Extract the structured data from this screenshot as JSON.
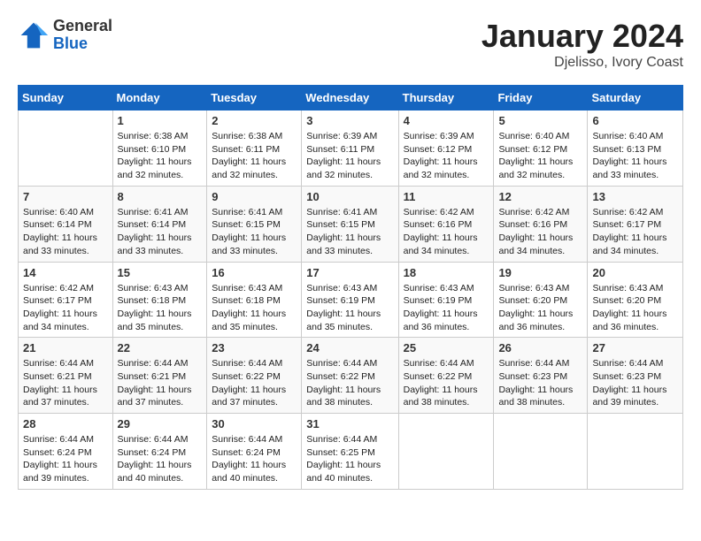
{
  "logo": {
    "general": "General",
    "blue": "Blue"
  },
  "title": "January 2024",
  "subtitle": "Djelisso, Ivory Coast",
  "days_of_week": [
    "Sunday",
    "Monday",
    "Tuesday",
    "Wednesday",
    "Thursday",
    "Friday",
    "Saturday"
  ],
  "weeks": [
    [
      {
        "num": "",
        "sunrise": "",
        "sunset": "",
        "daylight": ""
      },
      {
        "num": "1",
        "sunrise": "Sunrise: 6:38 AM",
        "sunset": "Sunset: 6:10 PM",
        "daylight": "Daylight: 11 hours and 32 minutes."
      },
      {
        "num": "2",
        "sunrise": "Sunrise: 6:38 AM",
        "sunset": "Sunset: 6:11 PM",
        "daylight": "Daylight: 11 hours and 32 minutes."
      },
      {
        "num": "3",
        "sunrise": "Sunrise: 6:39 AM",
        "sunset": "Sunset: 6:11 PM",
        "daylight": "Daylight: 11 hours and 32 minutes."
      },
      {
        "num": "4",
        "sunrise": "Sunrise: 6:39 AM",
        "sunset": "Sunset: 6:12 PM",
        "daylight": "Daylight: 11 hours and 32 minutes."
      },
      {
        "num": "5",
        "sunrise": "Sunrise: 6:40 AM",
        "sunset": "Sunset: 6:12 PM",
        "daylight": "Daylight: 11 hours and 32 minutes."
      },
      {
        "num": "6",
        "sunrise": "Sunrise: 6:40 AM",
        "sunset": "Sunset: 6:13 PM",
        "daylight": "Daylight: 11 hours and 33 minutes."
      }
    ],
    [
      {
        "num": "7",
        "sunrise": "Sunrise: 6:40 AM",
        "sunset": "Sunset: 6:14 PM",
        "daylight": "Daylight: 11 hours and 33 minutes."
      },
      {
        "num": "8",
        "sunrise": "Sunrise: 6:41 AM",
        "sunset": "Sunset: 6:14 PM",
        "daylight": "Daylight: 11 hours and 33 minutes."
      },
      {
        "num": "9",
        "sunrise": "Sunrise: 6:41 AM",
        "sunset": "Sunset: 6:15 PM",
        "daylight": "Daylight: 11 hours and 33 minutes."
      },
      {
        "num": "10",
        "sunrise": "Sunrise: 6:41 AM",
        "sunset": "Sunset: 6:15 PM",
        "daylight": "Daylight: 11 hours and 33 minutes."
      },
      {
        "num": "11",
        "sunrise": "Sunrise: 6:42 AM",
        "sunset": "Sunset: 6:16 PM",
        "daylight": "Daylight: 11 hours and 34 minutes."
      },
      {
        "num": "12",
        "sunrise": "Sunrise: 6:42 AM",
        "sunset": "Sunset: 6:16 PM",
        "daylight": "Daylight: 11 hours and 34 minutes."
      },
      {
        "num": "13",
        "sunrise": "Sunrise: 6:42 AM",
        "sunset": "Sunset: 6:17 PM",
        "daylight": "Daylight: 11 hours and 34 minutes."
      }
    ],
    [
      {
        "num": "14",
        "sunrise": "Sunrise: 6:42 AM",
        "sunset": "Sunset: 6:17 PM",
        "daylight": "Daylight: 11 hours and 34 minutes."
      },
      {
        "num": "15",
        "sunrise": "Sunrise: 6:43 AM",
        "sunset": "Sunset: 6:18 PM",
        "daylight": "Daylight: 11 hours and 35 minutes."
      },
      {
        "num": "16",
        "sunrise": "Sunrise: 6:43 AM",
        "sunset": "Sunset: 6:18 PM",
        "daylight": "Daylight: 11 hours and 35 minutes."
      },
      {
        "num": "17",
        "sunrise": "Sunrise: 6:43 AM",
        "sunset": "Sunset: 6:19 PM",
        "daylight": "Daylight: 11 hours and 35 minutes."
      },
      {
        "num": "18",
        "sunrise": "Sunrise: 6:43 AM",
        "sunset": "Sunset: 6:19 PM",
        "daylight": "Daylight: 11 hours and 36 minutes."
      },
      {
        "num": "19",
        "sunrise": "Sunrise: 6:43 AM",
        "sunset": "Sunset: 6:20 PM",
        "daylight": "Daylight: 11 hours and 36 minutes."
      },
      {
        "num": "20",
        "sunrise": "Sunrise: 6:43 AM",
        "sunset": "Sunset: 6:20 PM",
        "daylight": "Daylight: 11 hours and 36 minutes."
      }
    ],
    [
      {
        "num": "21",
        "sunrise": "Sunrise: 6:44 AM",
        "sunset": "Sunset: 6:21 PM",
        "daylight": "Daylight: 11 hours and 37 minutes."
      },
      {
        "num": "22",
        "sunrise": "Sunrise: 6:44 AM",
        "sunset": "Sunset: 6:21 PM",
        "daylight": "Daylight: 11 hours and 37 minutes."
      },
      {
        "num": "23",
        "sunrise": "Sunrise: 6:44 AM",
        "sunset": "Sunset: 6:22 PM",
        "daylight": "Daylight: 11 hours and 37 minutes."
      },
      {
        "num": "24",
        "sunrise": "Sunrise: 6:44 AM",
        "sunset": "Sunset: 6:22 PM",
        "daylight": "Daylight: 11 hours and 38 minutes."
      },
      {
        "num": "25",
        "sunrise": "Sunrise: 6:44 AM",
        "sunset": "Sunset: 6:22 PM",
        "daylight": "Daylight: 11 hours and 38 minutes."
      },
      {
        "num": "26",
        "sunrise": "Sunrise: 6:44 AM",
        "sunset": "Sunset: 6:23 PM",
        "daylight": "Daylight: 11 hours and 38 minutes."
      },
      {
        "num": "27",
        "sunrise": "Sunrise: 6:44 AM",
        "sunset": "Sunset: 6:23 PM",
        "daylight": "Daylight: 11 hours and 39 minutes."
      }
    ],
    [
      {
        "num": "28",
        "sunrise": "Sunrise: 6:44 AM",
        "sunset": "Sunset: 6:24 PM",
        "daylight": "Daylight: 11 hours and 39 minutes."
      },
      {
        "num": "29",
        "sunrise": "Sunrise: 6:44 AM",
        "sunset": "Sunset: 6:24 PM",
        "daylight": "Daylight: 11 hours and 40 minutes."
      },
      {
        "num": "30",
        "sunrise": "Sunrise: 6:44 AM",
        "sunset": "Sunset: 6:24 PM",
        "daylight": "Daylight: 11 hours and 40 minutes."
      },
      {
        "num": "31",
        "sunrise": "Sunrise: 6:44 AM",
        "sunset": "Sunset: 6:25 PM",
        "daylight": "Daylight: 11 hours and 40 minutes."
      },
      {
        "num": "",
        "sunrise": "",
        "sunset": "",
        "daylight": ""
      },
      {
        "num": "",
        "sunrise": "",
        "sunset": "",
        "daylight": ""
      },
      {
        "num": "",
        "sunrise": "",
        "sunset": "",
        "daylight": ""
      }
    ]
  ]
}
